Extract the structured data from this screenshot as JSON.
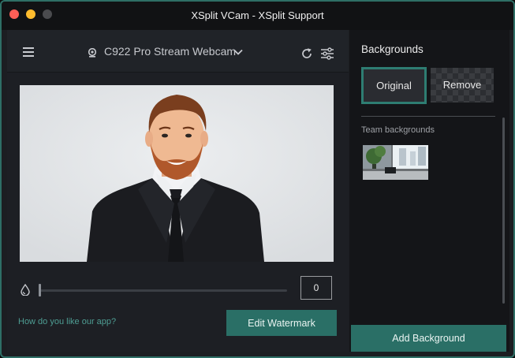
{
  "window": {
    "title": "XSplit VCam - XSplit Support"
  },
  "toolbar": {
    "camera_name": "C922 Pro Stream Webcam",
    "icons": [
      "menu-icon",
      "webcam-icon",
      "chevron-down-icon",
      "refresh-icon",
      "settings-sliders-icon"
    ]
  },
  "blur": {
    "value": "0",
    "level": 0,
    "icon": "droplet-icon"
  },
  "footer": {
    "feedback_link": "How do you like our app?",
    "watermark_button": "Edit Watermark"
  },
  "backgrounds": {
    "title": "Backgrounds",
    "original_label": "Original",
    "remove_label": "Remove",
    "team_label": "Team backgrounds",
    "add_button": "Add Background"
  },
  "colors": {
    "accent": "#2a6f66",
    "link": "#4e9d93",
    "selected_border": "#2e7d72"
  }
}
